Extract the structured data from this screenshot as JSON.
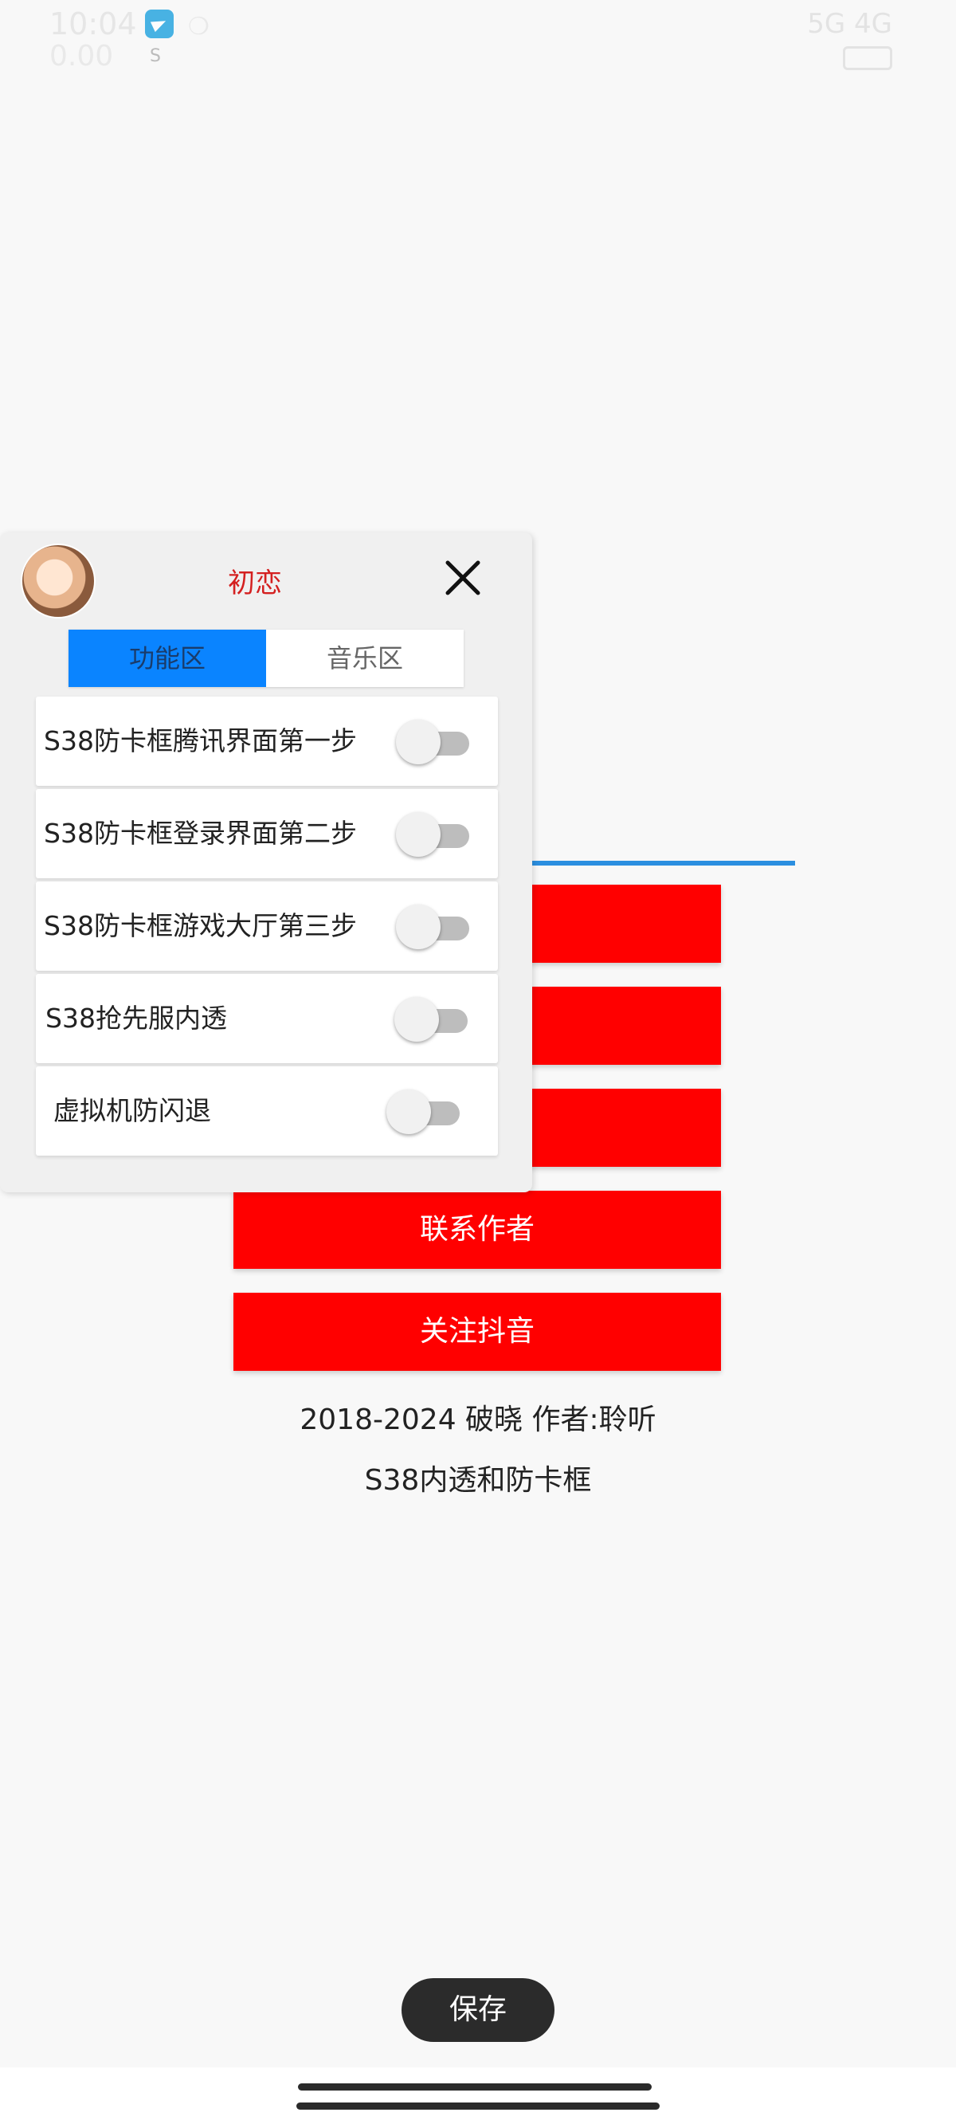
{
  "status_bar": {
    "time": "10:04",
    "sub": "0.00",
    "extra": "❍",
    "s_icon": "S",
    "network": "5G 4G",
    "battery_icon": "battery-icon"
  },
  "panel": {
    "title": "初恋",
    "close_icon": "close-icon",
    "tabs": [
      {
        "label": "功能区",
        "active": true
      },
      {
        "label": "音乐区",
        "active": false
      }
    ],
    "toggles": [
      {
        "label": "S38防卡框腾讯界面第一步",
        "on": false
      },
      {
        "label": "S38防卡框登录界面第二步",
        "on": false
      },
      {
        "label": "S38防卡框游戏大厅第三步",
        "on": false
      },
      {
        "label": "S38抢先服内透",
        "on": false
      },
      {
        "label": "虚拟机防闪退",
        "on": false
      }
    ]
  },
  "background_app": {
    "buttons": [
      {
        "label": ""
      },
      {
        "label": ""
      },
      {
        "label": ""
      },
      {
        "label": "联系作者"
      },
      {
        "label": "关注抖音"
      }
    ],
    "copyright": "2018-2024 破晓  作者:聆听",
    "subtitle": "S38内透和防卡框"
  },
  "toast": {
    "label": "保存"
  },
  "colors": {
    "accent_red": "#ff0000",
    "tab_active": "#0a84ff",
    "title_red": "#d42020",
    "blue_line": "#2b8fe0"
  }
}
